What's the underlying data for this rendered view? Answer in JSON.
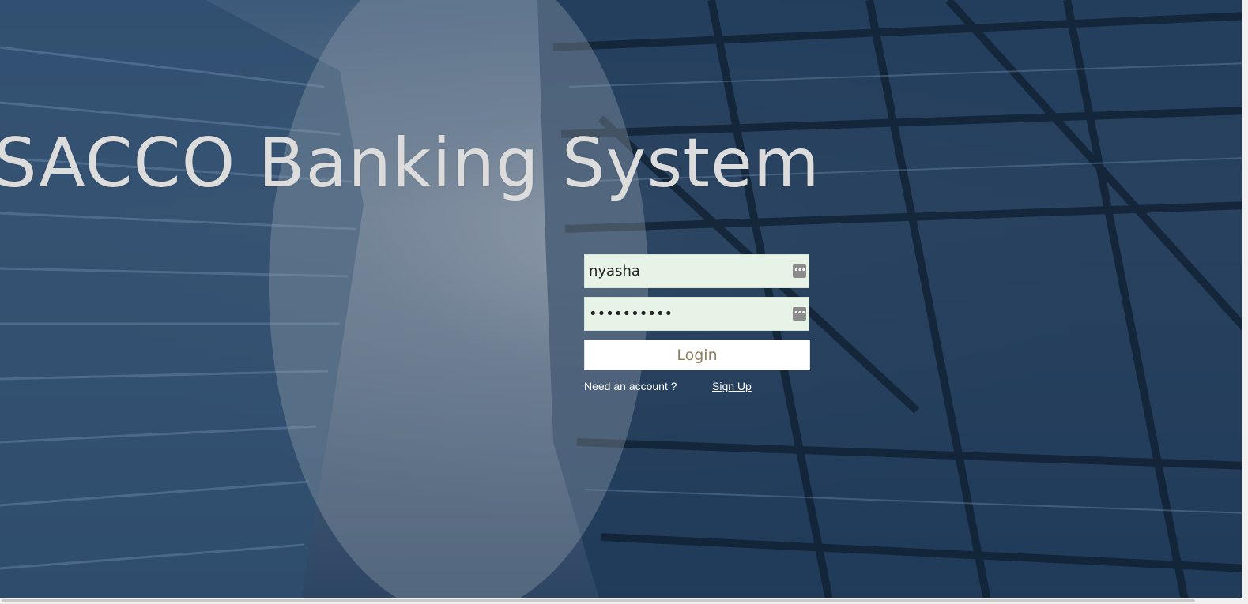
{
  "page": {
    "title": "SACCO Banking System"
  },
  "login_form": {
    "username_value": "nyasha",
    "password_value": "••••••••••",
    "field_icon_glyph": "•••",
    "login_label": "Login",
    "need_account_text": "Need an account ?",
    "signup_label": "Sign Up"
  },
  "colors": {
    "title": "#dcdcdc",
    "field_background": "#e8f3e8",
    "login_text": "#8c7e5e",
    "link_text": "#ffffff"
  },
  "icons": {
    "field_icon": "password-manager-icon"
  }
}
